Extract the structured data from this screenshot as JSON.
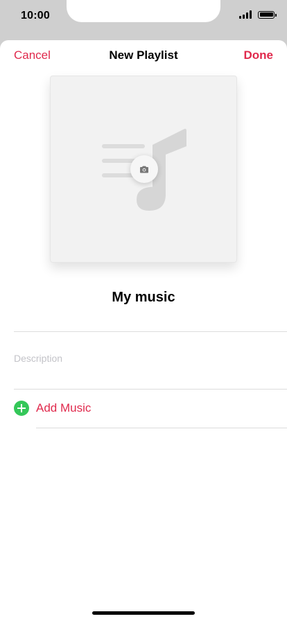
{
  "status_bar": {
    "time": "10:00"
  },
  "nav": {
    "cancel_label": "Cancel",
    "title": "New Playlist",
    "done_label": "Done"
  },
  "playlist": {
    "name": "My music",
    "description_placeholder": "Description"
  },
  "actions": {
    "add_music_label": "Add Music"
  },
  "icons": {
    "artwork": "music-note-icon",
    "camera": "camera-icon",
    "add": "plus-circle-icon"
  },
  "colors": {
    "accent": "#e0294c",
    "add_green": "#34c759"
  }
}
